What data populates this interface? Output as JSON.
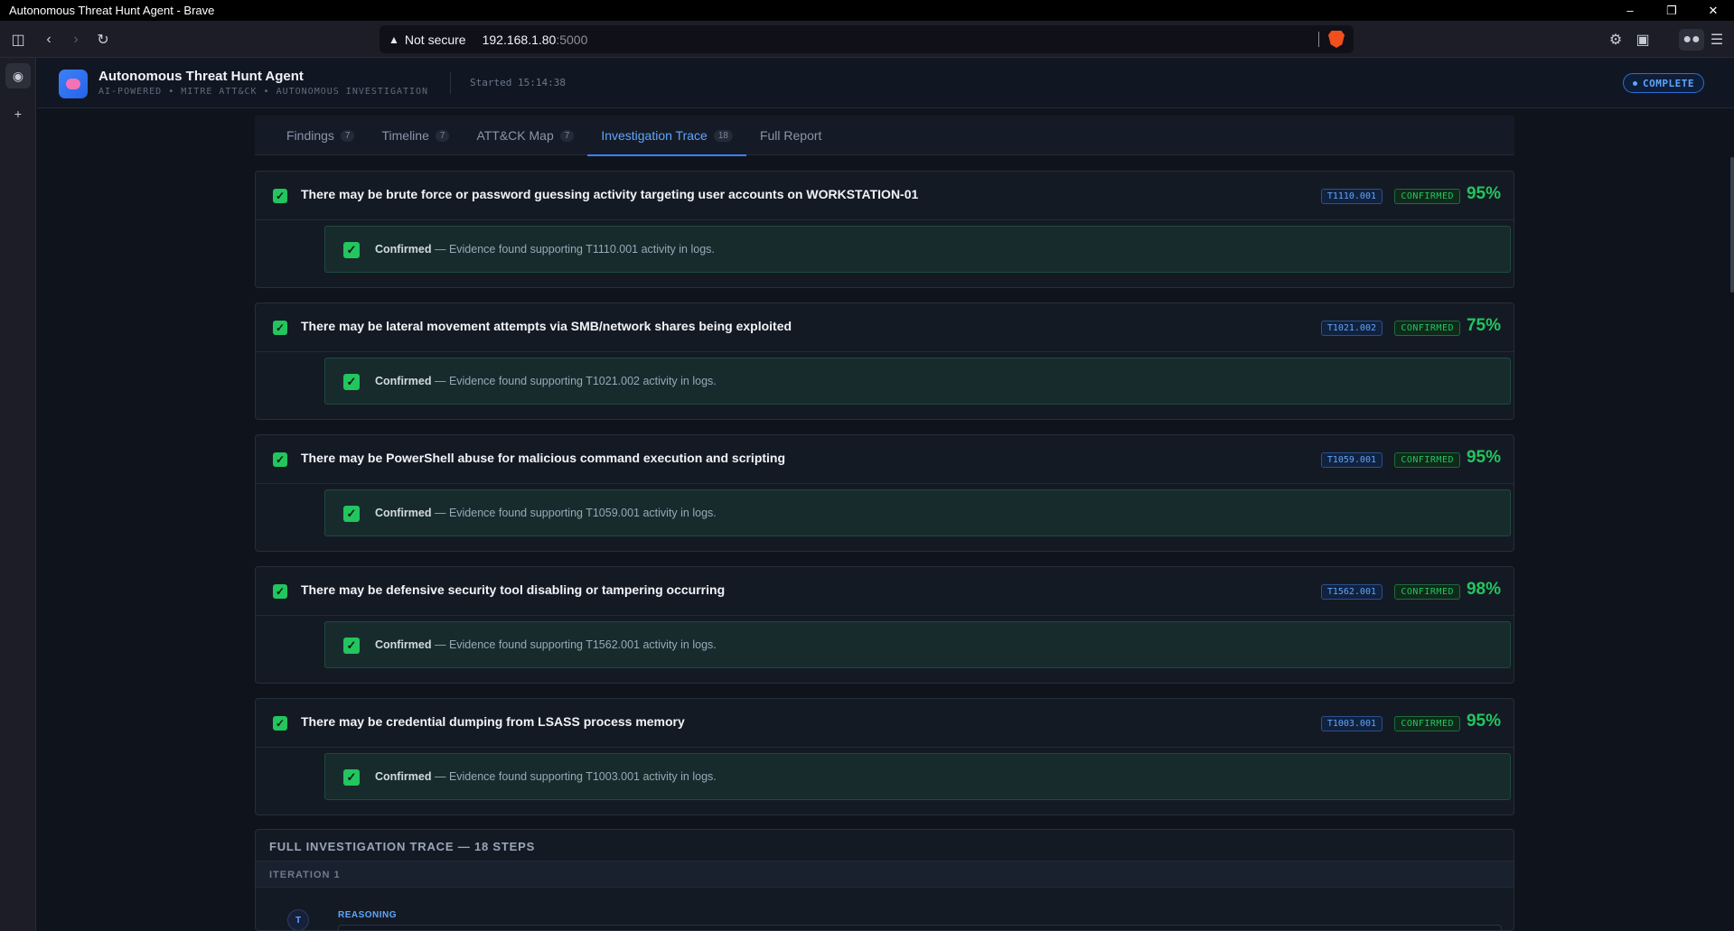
{
  "window": {
    "title": "Autonomous Threat Hunt Agent - Brave"
  },
  "browser": {
    "security_label": "Not secure",
    "url_host": "192.168.1.80",
    "url_port": ":5000"
  },
  "app": {
    "title": "Autonomous Threat Hunt Agent",
    "subtitle": "AI-POWERED • MITRE ATT&CK • AUTONOMOUS INVESTIGATION",
    "started": "Started 15:14:38",
    "status": "COMPLETE"
  },
  "tabs": [
    {
      "label": "Findings",
      "count": "7"
    },
    {
      "label": "Timeline",
      "count": "7"
    },
    {
      "label": "ATT&CK Map",
      "count": "7"
    },
    {
      "label": "Investigation Trace",
      "count": "18"
    },
    {
      "label": "Full Report",
      "count": ""
    }
  ],
  "hypotheses": [
    {
      "text": "There may be brute force or password guessing activity targeting user accounts on WORKSTATION-01",
      "technique": "T1110.001",
      "status": "CONFIRMED",
      "confidence": "95%",
      "evidence_label": "Confirmed",
      "evidence_text": " — Evidence found supporting T1110.001 activity in logs."
    },
    {
      "text": "There may be lateral movement attempts via SMB/network shares being exploited",
      "technique": "T1021.002",
      "status": "CONFIRMED",
      "confidence": "75%",
      "evidence_label": "Confirmed",
      "evidence_text": " — Evidence found supporting T1021.002 activity in logs."
    },
    {
      "text": "There may be PowerShell abuse for malicious command execution and scripting",
      "technique": "T1059.001",
      "status": "CONFIRMED",
      "confidence": "95%",
      "evidence_label": "Confirmed",
      "evidence_text": " — Evidence found supporting T1059.001 activity in logs."
    },
    {
      "text": "There may be defensive security tool disabling or tampering occurring",
      "technique": "T1562.001",
      "status": "CONFIRMED",
      "confidence": "98%",
      "evidence_label": "Confirmed",
      "evidence_text": " — Evidence found supporting T1562.001 activity in logs."
    },
    {
      "text": "There may be credential dumping from LSASS process memory",
      "technique": "T1003.001",
      "status": "CONFIRMED",
      "confidence": "95%",
      "evidence_label": "Confirmed",
      "evidence_text": " — Evidence found supporting T1003.001 activity in logs."
    }
  ],
  "trace": {
    "title": "FULL INVESTIGATION TRACE — 18 STEPS",
    "iteration": "ITERATION 1",
    "step_avatar": "T",
    "step_label": "REASONING"
  },
  "colors": {
    "accent": "#3b82f6",
    "success": "#22c55e",
    "background": "#0f141c"
  }
}
